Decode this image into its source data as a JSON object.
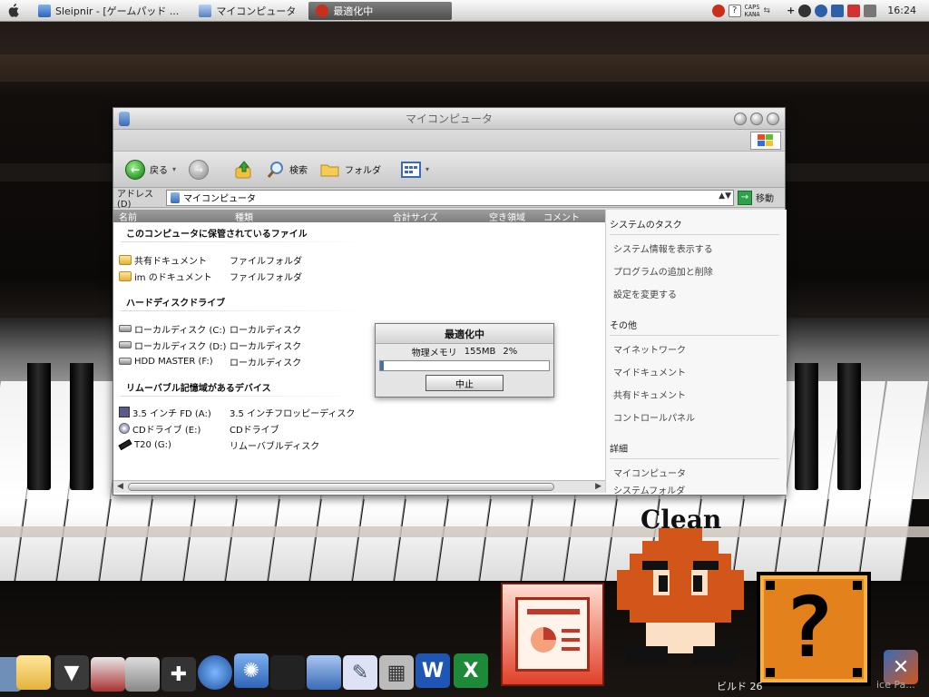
{
  "menubar": {
    "tasks": [
      {
        "label": "Sleipnir - [ゲームパッド ..."
      },
      {
        "label": "マイコンピュータ"
      },
      {
        "label": "最適化中"
      }
    ],
    "caps_line1": "CAPS",
    "caps_line2": "KANA",
    "tray_plus": "+",
    "clock": "16:24"
  },
  "window": {
    "title": "マイコンピュータ",
    "toolbar": {
      "back": "戻る",
      "search": "検索",
      "folders": "フォルダ"
    },
    "address": {
      "label": "アドレス(D)",
      "value": "マイコンピュータ",
      "go": "移動"
    },
    "columns": [
      "名前",
      "種類",
      "合計サイズ",
      "空き領域",
      "コメント"
    ],
    "groups": {
      "stored_files": {
        "title": "このコンピュータに保管されているファイル",
        "items": [
          {
            "name": "共有ドキュメント",
            "type": "ファイルフォルダ"
          },
          {
            "name": "im のドキュメント",
            "type": "ファイルフォルダ"
          }
        ]
      },
      "hard_disks": {
        "title": "ハードディスクドライブ",
        "items": [
          {
            "name": "ローカルディスク (C:)",
            "type": "ローカルディスク"
          },
          {
            "name": "ローカルディスク (D:)",
            "type": "ローカルディスク"
          },
          {
            "name": "HDD MASTER (F:)",
            "type": "ローカルディスク"
          }
        ]
      },
      "removable": {
        "title": "リムーバブル記憶域があるデバイス",
        "items": [
          {
            "name": "3.5 インチ FD (A:)",
            "type": "3.5 インチフロッピーディスク"
          },
          {
            "name": "CDドライブ (E:)",
            "type": "CDドライブ"
          },
          {
            "name": "T20 (G:)",
            "type": "リムーバブルディスク"
          }
        ]
      }
    },
    "taskpane": {
      "system_tasks": {
        "title": "システムのタスク",
        "items": [
          "システム情報を表示する",
          "プログラムの追加と削除",
          "設定を変更する"
        ]
      },
      "other": {
        "title": "その他",
        "items": [
          "マイネットワーク",
          "マイドキュメント",
          "共有ドキュメント",
          "コントロールパネル"
        ]
      },
      "details": {
        "title": "詳細",
        "items": [
          "マイコンピュータ",
          "システムフォルダ"
        ]
      }
    }
  },
  "dialog": {
    "title": "最適化中",
    "label": "物理メモリ",
    "memory": "155MB",
    "percent": "2%",
    "progress": 0.02,
    "button": "中止"
  },
  "widget": {
    "clean_label": "Clean"
  },
  "dock": {
    "build_text": "ビルド 26",
    "build_text_2": "ice Pa..."
  },
  "colors": {
    "progress_fill": "#4a6fa5",
    "goomba_brown": "#d2561a",
    "qblock_orange": "#e3821c"
  }
}
